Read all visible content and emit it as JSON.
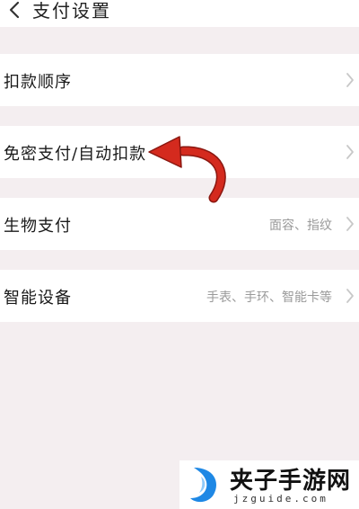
{
  "header": {
    "title": "支付设置",
    "back_icon": "chevron-left-icon"
  },
  "rows": [
    {
      "label": "扣款顺序",
      "value": ""
    },
    {
      "label": "免密支付/自动扣款",
      "value": ""
    },
    {
      "label": "生物支付",
      "value": "面容、指纹"
    },
    {
      "label": "智能设备",
      "value": "手表、手环、智能卡等"
    }
  ],
  "annotation": {
    "arrow_color": "#d42a1e",
    "arrow_icon": "curved-arrow-icon"
  },
  "watermark": {
    "title": "夹子手游网",
    "subtitle": "jzguide.com",
    "logo_color": "#1e88e5"
  },
  "colors": {
    "background": "#f4eef0",
    "chevron": "#c8c8c8",
    "value_text": "#9a9a9a"
  }
}
